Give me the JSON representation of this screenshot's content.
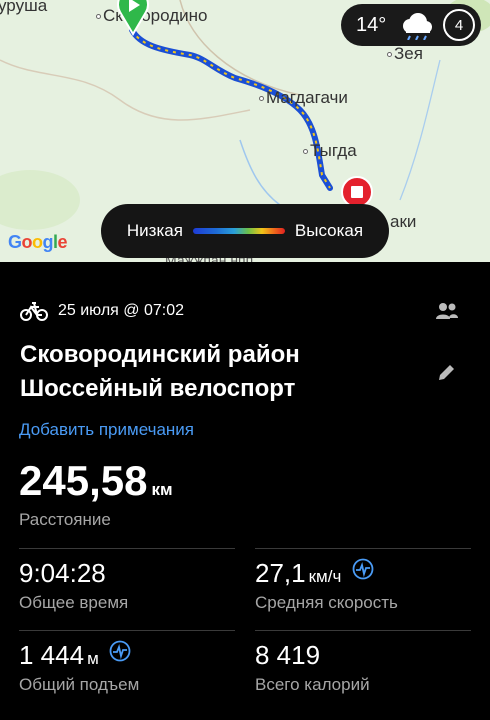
{
  "map": {
    "towns": {
      "urusha": "урушa",
      "skovorodino": "Сковородино",
      "zeya": "Зея",
      "magdagachi": "Магдагачи",
      "tygda": "Тыгда",
      "shimanovsk_partial": "аки",
      "bottom_partial": "Мажжпан нпп"
    },
    "weather": {
      "temp": "14°",
      "aqi": "4"
    },
    "google_logo": "Google",
    "legend": {
      "low": "Низкая",
      "high": "Высокая"
    }
  },
  "activity": {
    "date": "25 июля @ 07:02",
    "title": "Сковородинский район Шоссейный велоспорт",
    "add_notes": "Добавить примечания",
    "distance": {
      "value": "245,58",
      "unit": "км",
      "label": "Расстояние"
    },
    "total_time": {
      "value": "9:04:28",
      "label": "Общее время"
    },
    "avg_speed": {
      "value": "27,1",
      "unit": "км/ч",
      "label": "Средняя скорость"
    },
    "elevation": {
      "value": "1 444",
      "unit": "м",
      "label": "Общий подъем"
    },
    "calories": {
      "value": "8 419",
      "label": "Всего калорий"
    }
  }
}
